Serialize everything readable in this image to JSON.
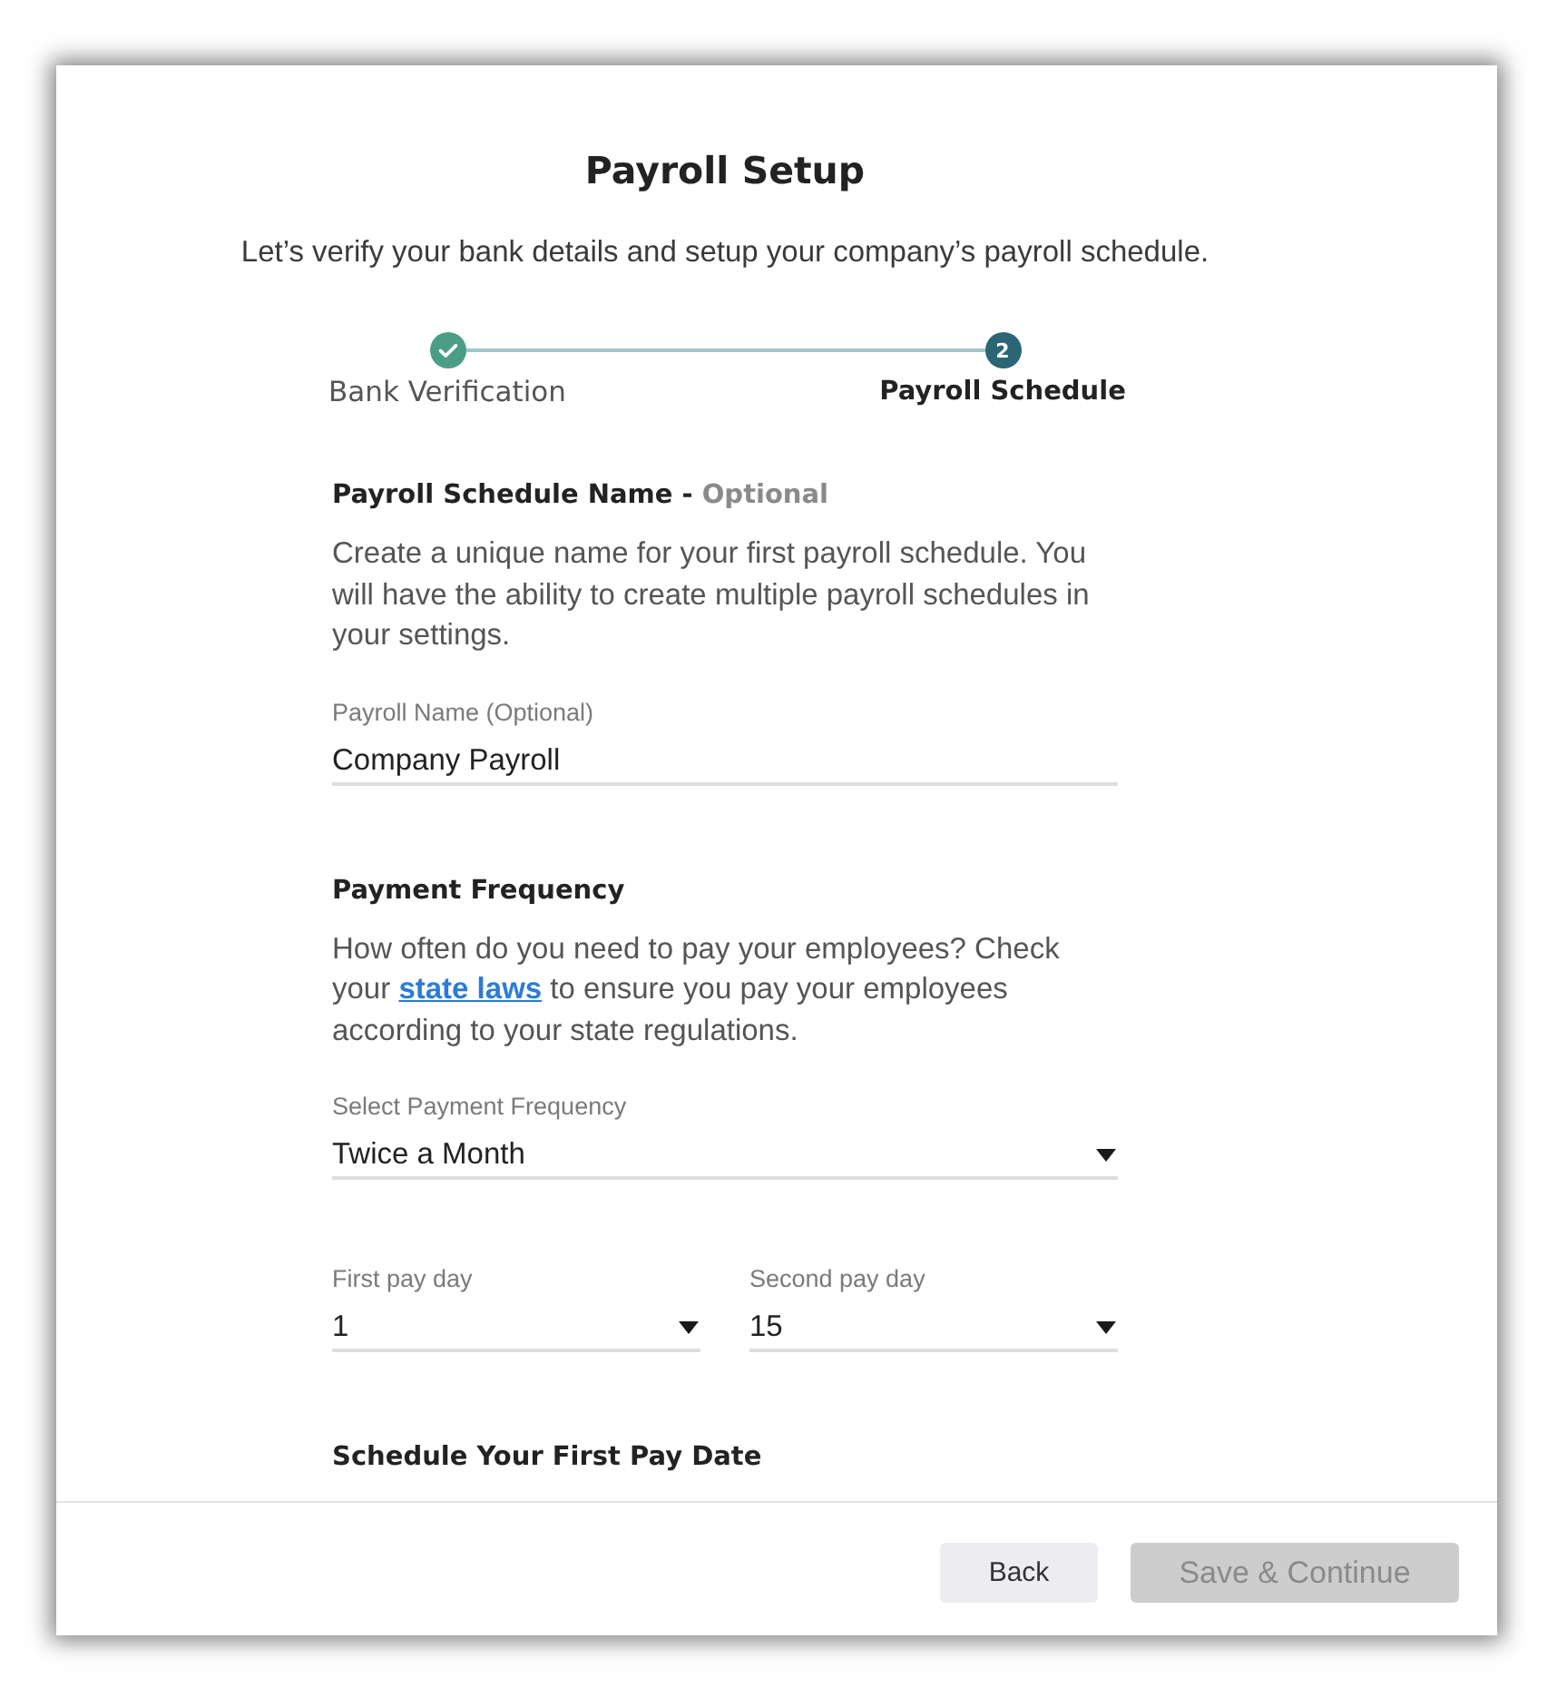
{
  "dialog": {
    "title": "Payroll Setup",
    "subtitle": "Let’s verify your bank details and setup your company’s payroll schedule."
  },
  "steps": [
    {
      "label": "Bank Verification",
      "completed": true,
      "selected": false
    },
    {
      "number": "2",
      "label": "Payroll Schedule",
      "completed": false,
      "selected": true
    }
  ],
  "sections": [
    {
      "title": "Payroll Schedule Name -",
      "title_note": "Optional",
      "description": [
        {
          "kind": "text",
          "text": "Create a unique name for your first payroll schedule. You will have the ability to create multiple payroll schedules in your settings."
        }
      ],
      "field_rows": [
        [
          {
            "kind": "text",
            "label": "Payroll Name (Optional)",
            "value": "Company Payroll"
          }
        ]
      ]
    },
    {
      "title": "Payment Frequency",
      "description": [
        {
          "kind": "text",
          "text": "How often do you need to pay your employees? Check your"
        },
        {
          "kind": "link",
          "text": "state laws"
        },
        {
          "kind": "text",
          "text": "to ensure you pay your employees according to your state regulations."
        }
      ],
      "field_rows": [
        [
          {
            "kind": "select",
            "label": "Select Payment Frequency",
            "value": "Twice a Month"
          }
        ],
        [
          {
            "kind": "select",
            "label": "First pay day",
            "value": "1"
          },
          {
            "kind": "select",
            "label": "Second pay day",
            "value": "15"
          }
        ]
      ]
    },
    {
      "title": "Schedule Your First Pay Date"
    }
  ],
  "buttons": [
    {
      "label": "Back",
      "kind": "back",
      "disabled": false
    },
    {
      "label": "Save & Continue",
      "kind": "submit",
      "disabled": true
    }
  ]
}
